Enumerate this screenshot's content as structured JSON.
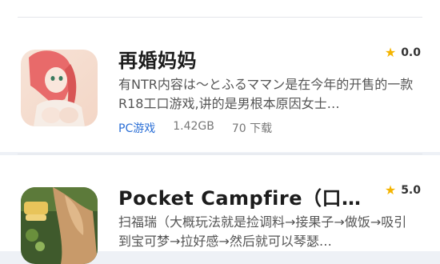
{
  "items": [
    {
      "title": "再婚妈妈",
      "rating": "0.0",
      "description": "有NTR内容は～とふるママン是在今年的开售的一款R18工口游戏,讲的是男根本原因女士…",
      "category": "PC游戏",
      "size": "1.42GB",
      "downloads": "70 下载"
    },
    {
      "title": "Pocket Campfire（口袋篝…",
      "rating": "5.0",
      "description": "扫福瑞（大概玩法就是捡调料→接果子→做饭→吸引到宝可梦→拉好感→然后就可以琴瑟…"
    }
  ],
  "icons": {
    "star": "star-icon"
  },
  "colors": {
    "accent": "#2b6fd6",
    "star": "#f4b400"
  }
}
